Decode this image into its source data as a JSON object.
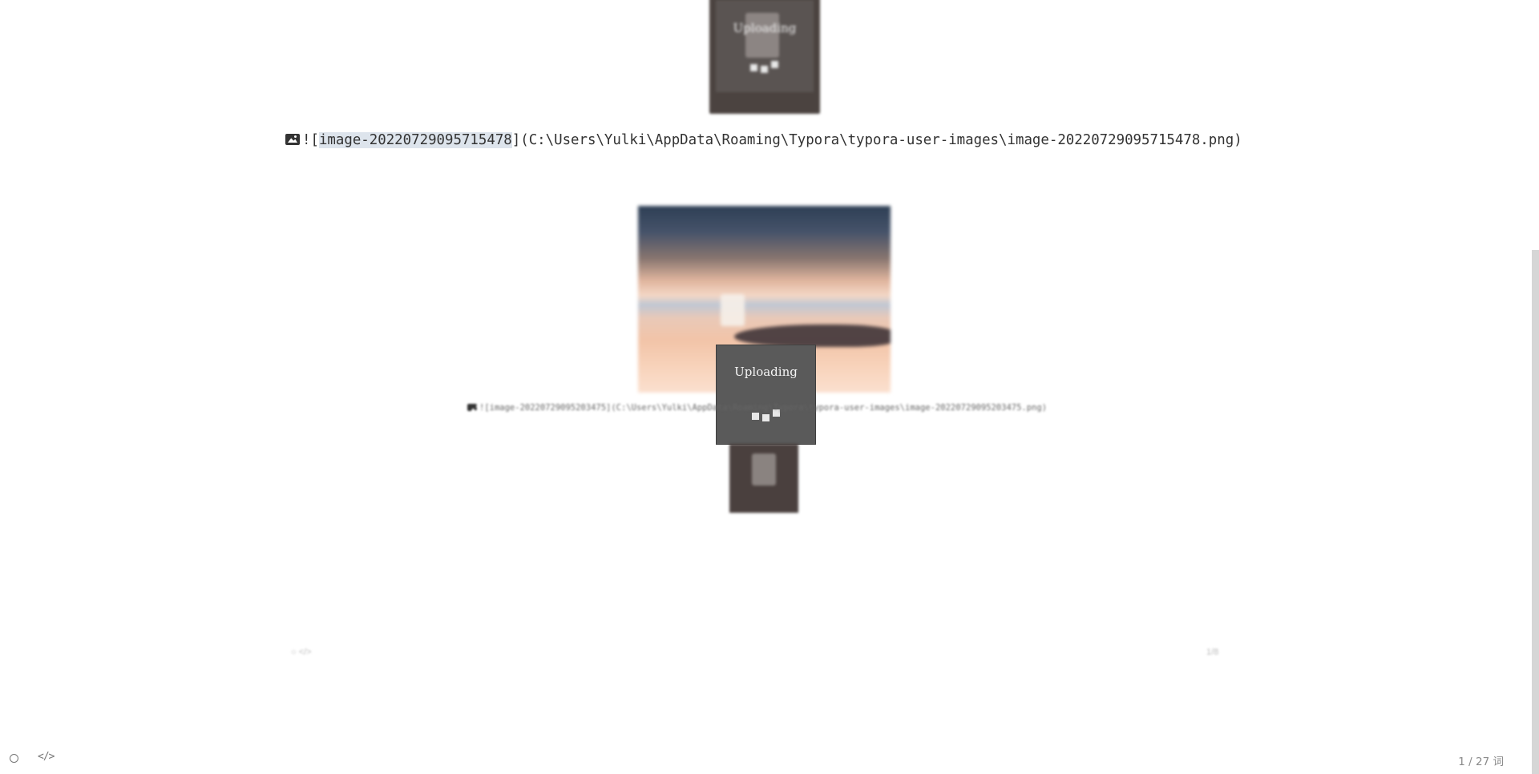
{
  "uploads": {
    "top_label": "Uploading",
    "mid_label": "Uploading"
  },
  "markdown": {
    "prefix": "![",
    "alt_text": "image-20220729095715478",
    "suffix": "](C:\\Users\\Yulki\\AppData\\Roaming\\Typora\\typora-user-images\\image-20220729095715478.png)"
  },
  "blurred_markdown": {
    "text": "![image-20220729095203475](C:\\Users\\Yulki\\AppData\\Roaming\\Typora\\typora-user-images\\image-20220729095203475.png)"
  },
  "footer": {
    "word_count": "1 / 27 词",
    "left_icon": "circle-icon",
    "code_icon": "code-icon"
  },
  "colors": {
    "highlight": "#dde4ec",
    "text": "#333333",
    "scrollbar_thumb": "#d6d6d6"
  }
}
